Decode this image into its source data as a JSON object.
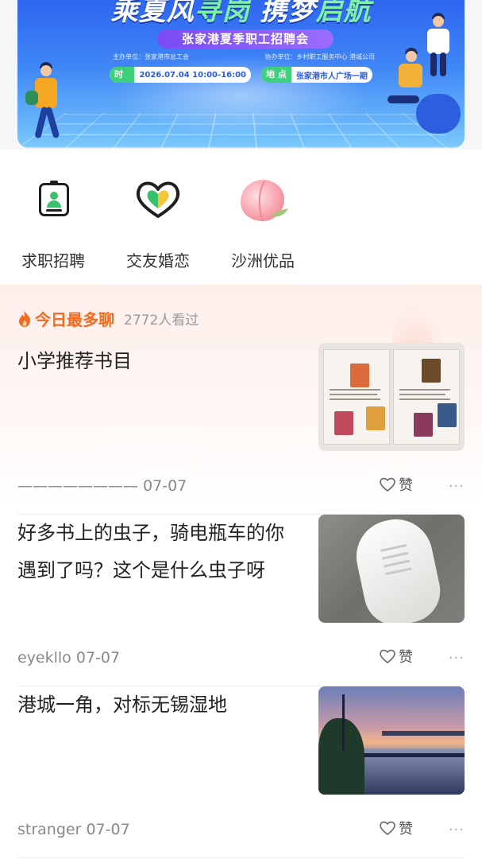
{
  "banner": {
    "headline_a": "乘夏风",
    "headline_b": "寻岗",
    "headline_c": " 携梦",
    "headline_d": "启航",
    "subtitle": "张家港夏季职工招聘会",
    "organizer": "主办单位：张家港市总工会",
    "co_organizer": "协办单位：乡村职工服务中心 港城公司",
    "time_tag": "时 间",
    "time_value": "2026.07.04 10:00-16:00",
    "place_tag": "地 点",
    "place_value": "张家港市人广场一期"
  },
  "categories": [
    {
      "label": "求职招聘",
      "icon": "id-card-icon"
    },
    {
      "label": "交友婚恋",
      "icon": "heart-icon"
    },
    {
      "label": "沙洲优品",
      "icon": "peach-icon"
    }
  ],
  "hot": {
    "title": "今日最多聊",
    "views": "2772人看过"
  },
  "posts": [
    {
      "title": "小学推荐书目",
      "author": "————————",
      "date": "07-07",
      "like_label": "赞",
      "more_label": "···",
      "thumb": "book-list-photo"
    },
    {
      "title": "好多书上的虫子，骑电瓶车的你遇到了吗？这个是什么虫子呀",
      "author": "eyekllo",
      "date": "07-07",
      "like_label": "赞",
      "more_label": "···",
      "thumb": "shoe-photo"
    },
    {
      "title": "港城一角，对标无锡湿地",
      "author": "stranger",
      "date": "07-07",
      "like_label": "赞",
      "more_label": "···",
      "thumb": "waterfront-sunset-photo"
    }
  ],
  "colors": {
    "accent_orange": "#f46a1e",
    "banner_blue": "#3f86f6",
    "banner_green": "#7ff0a8",
    "subtitle_purple": "#8a5cf8"
  }
}
